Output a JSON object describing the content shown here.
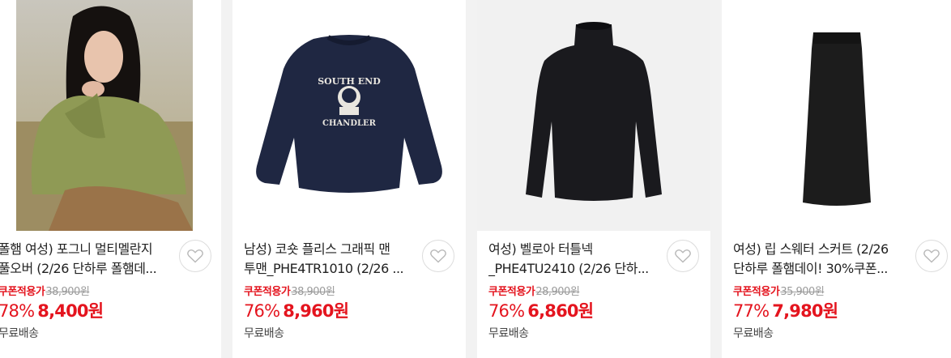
{
  "products": [
    {
      "title_line1": "폴햄 여성) 포그니 멀티멜란지",
      "title_line2": "풀오버 (2/26 단하루 폴햄데...",
      "coupon_label": "쿠폰적용가",
      "original_price": "38,900",
      "original_unit": "원",
      "discount_rate": "78%",
      "sale_price": "8,400원",
      "shipping": "무료배송",
      "image": "woman-in-green-knit-sweater"
    },
    {
      "title_line1": "남성) 코숏 플리스 그래픽 맨",
      "title_line2": "투맨_PHE4TR1010 (2/26 ...",
      "coupon_label": "쿠폰적용가",
      "original_price": "38,900",
      "original_unit": "원",
      "discount_rate": "76%",
      "sale_price": "8,960원",
      "shipping": "무료배송",
      "image": "navy-sweatshirt",
      "print_top": "SOUTH END",
      "print_bottom": "CHANDLER"
    },
    {
      "title_line1": "여성) 벨로아 터틀넥",
      "title_line2": "_PHE4TU2410 (2/26 단하...",
      "coupon_label": "쿠폰적용가",
      "original_price": "28,900",
      "original_unit": "원",
      "discount_rate": "76%",
      "sale_price": "6,860원",
      "shipping": "무료배송",
      "image": "black-velour-turtleneck"
    },
    {
      "title_line1": "여성) 립 스웨터 스커트 (2/26",
      "title_line2": "단하루 폴햄데이! 30%쿠폰...",
      "coupon_label": "쿠폰적용가",
      "original_price": "35,900",
      "original_unit": "원",
      "discount_rate": "77%",
      "sale_price": "7,980원",
      "shipping": "무료배송",
      "image": "black-rib-skirt"
    }
  ],
  "icons": {
    "wishlist": "heart-icon"
  },
  "colors": {
    "price_red": "#e4141e",
    "strike_gray": "#9a9a9a",
    "background": "#f2f2f2"
  }
}
